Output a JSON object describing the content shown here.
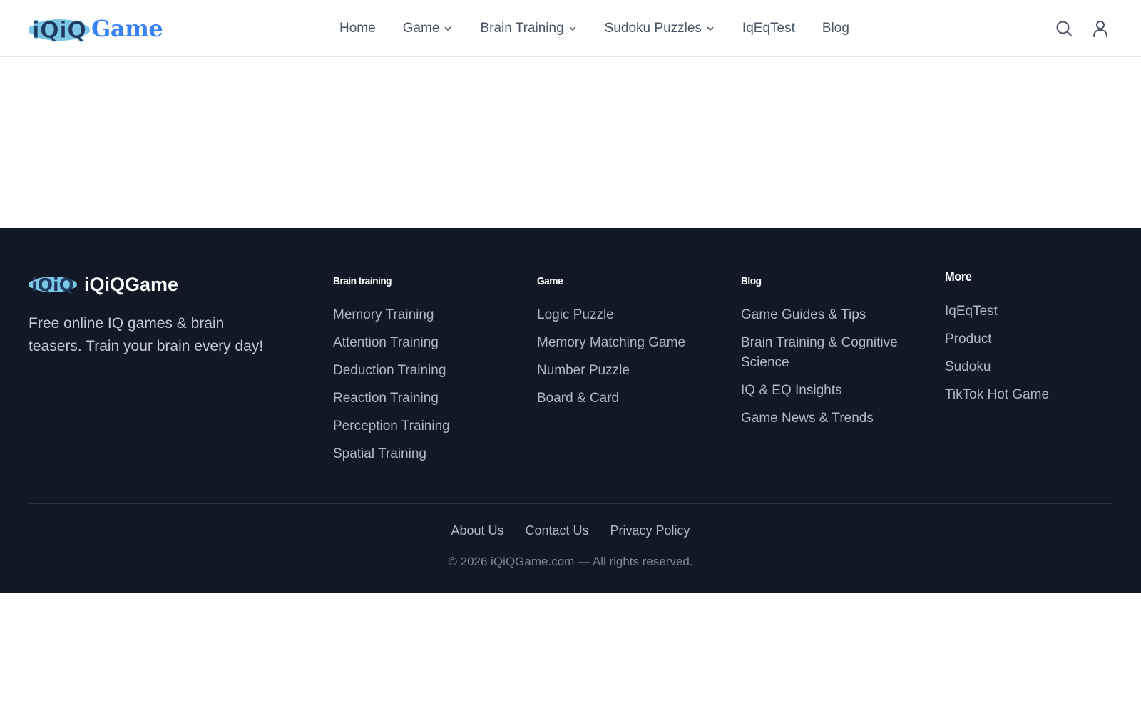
{
  "header": {
    "logo_text": "iQiQ",
    "logo_word": "Game",
    "nav": [
      {
        "label": "Home",
        "has_dropdown": false
      },
      {
        "label": "Game",
        "has_dropdown": true
      },
      {
        "label": "Brain Training",
        "has_dropdown": true
      },
      {
        "label": "Sudoku Puzzles",
        "has_dropdown": true
      },
      {
        "label": "IqEqTest",
        "has_dropdown": false
      },
      {
        "label": "Blog",
        "has_dropdown": false
      }
    ],
    "icons": {
      "search": "search-icon",
      "user": "user-icon",
      "chevron": "chevron-down-icon"
    }
  },
  "footer": {
    "brand_name": "iQiQGame",
    "tagline": "Free online IQ games & brain teasers. Train your brain every day!",
    "columns": [
      {
        "title": "Brain training",
        "links": [
          "Memory Training",
          "Attention Training",
          "Deduction Training",
          "Reaction Training",
          "Perception Training",
          "Spatial Training"
        ]
      },
      {
        "title": "Game",
        "links": [
          "Logic Puzzle",
          "Memory Matching Game",
          "Number Puzzle",
          "Board & Card"
        ]
      },
      {
        "title": "Blog",
        "links": [
          "Game Guides & Tips",
          "Brain Training & Cognitive Science",
          "IQ & EQ Insights",
          "Game News & Trends"
        ]
      },
      {
        "title": "More",
        "links": [
          "IqEqTest",
          "Product",
          "Sudoku",
          "TikTok Hot Game"
        ]
      }
    ],
    "bottom_links": [
      "About Us",
      "Contact Us",
      "Privacy Policy"
    ],
    "copyright": "© 2026 iQiQGame.com — All rights reserved."
  },
  "colors": {
    "brand_blue": "#3b82f6",
    "footer_bg": "#121826",
    "nav_text": "#4b5563"
  }
}
